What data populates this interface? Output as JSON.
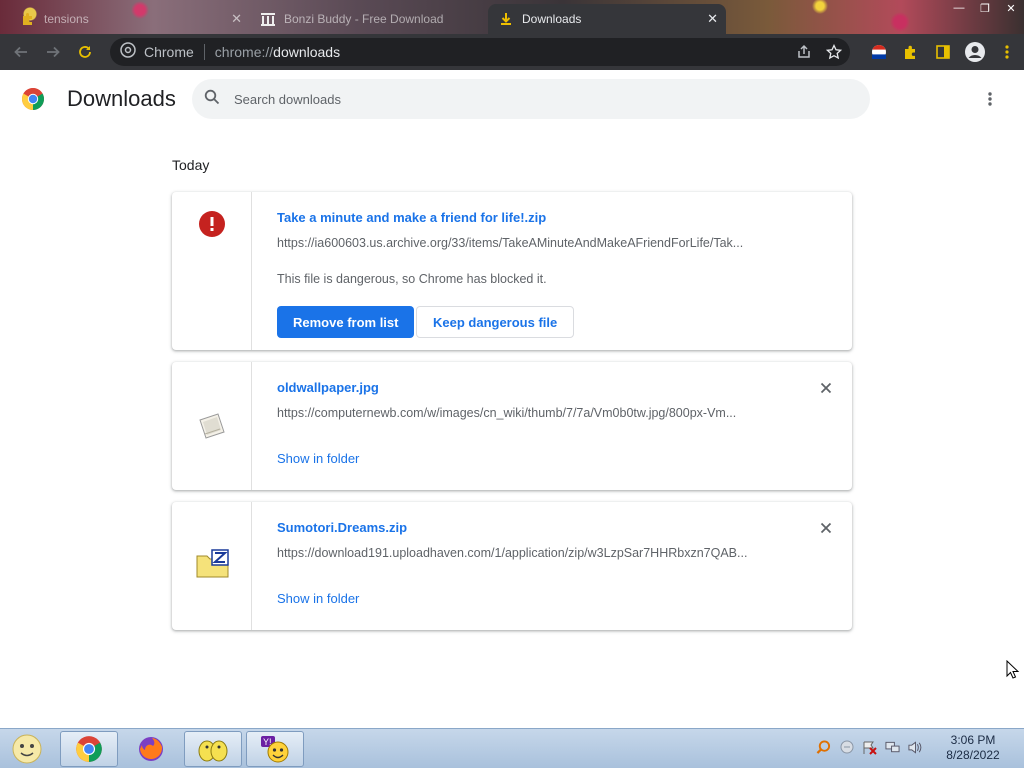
{
  "browser": {
    "tabs": [
      {
        "label": "tensions",
        "icon": "puzzle-icon",
        "active": false
      },
      {
        "label": "Bonzi Buddy - Free Download",
        "icon": "archive-icon",
        "active": false
      },
      {
        "label": "Downloads",
        "icon": "download-icon",
        "active": true
      }
    ],
    "omnibox": {
      "site_label": "Chrome",
      "url_scheme": "chrome://",
      "url_host": "downloads"
    }
  },
  "page": {
    "title": "Downloads",
    "search_placeholder": "Search downloads",
    "section": "Today"
  },
  "downloads": [
    {
      "name": "Take a minute and make a friend for life!.zip",
      "url": "https://ia600603.us.archive.org/33/items/TakeAMinuteAndMakeAFriendForLife/Tak...",
      "status": "This file is dangerous, so Chrome has blocked it.",
      "primary_action": "Remove from list",
      "secondary_action": "Keep dangerous file",
      "icon": "danger-icon"
    },
    {
      "name": "oldwallpaper.jpg",
      "url": "https://computernewb.com/w/images/cn_wiki/thumb/7/7a/Vm0b0tw.jpg/800px-Vm...",
      "action": "Show in folder",
      "icon": "image-file-icon"
    },
    {
      "name": "Sumotori.Dreams.zip",
      "url": "https://download191.uploadhaven.com/1/application/zip/w3LzpSar7HHRbxzn7QAB...",
      "action": "Show in folder",
      "icon": "zip-folder-icon"
    }
  ],
  "taskbar": {
    "apps": [
      "chrome-icon",
      "firefox-icon",
      "bonzi-buddy-icon",
      "yahoo-messenger-icon"
    ],
    "clock_time": "3:06 PM",
    "clock_date": "8/28/2022"
  },
  "colors": {
    "accent": "#1a73e8",
    "danger": "#d93025",
    "toolbar": "#35363a",
    "omnibox": "#202124"
  }
}
